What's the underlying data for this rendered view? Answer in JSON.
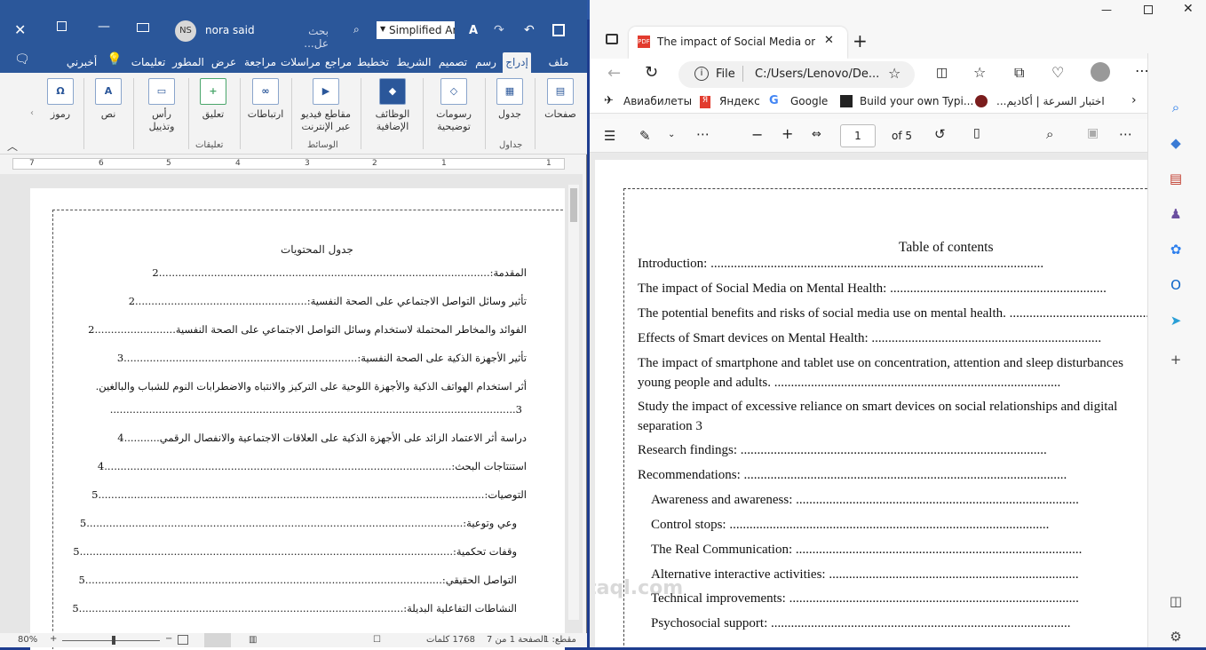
{
  "word": {
    "user_initials": "NS",
    "user_name": "nora said",
    "search_placeholder": "بحث عل...",
    "font_name": "Simplified Ara",
    "tabs": [
      "ملف",
      "إدراج",
      "رسم",
      "تصميم",
      "الشريط",
      "تخطيط",
      "مراجع",
      "مراسلات",
      "مراجعة",
      "عرض",
      "المطور",
      "تعليمات",
      "أخبرني"
    ],
    "active_tab": "إدراج",
    "ribbon": {
      "pages": "صفحات",
      "table": "جدول",
      "illustrations": "رسومات توضيحية",
      "addins": "الوظائف الإضافية",
      "online_video": "مقاطع فيديو عبر الإنترنت",
      "links": "ارتباطات",
      "comment": "تعليق",
      "header_footer": "رأس وتذييل",
      "text": "نص",
      "symbols": "رموز",
      "group_tables": "جداول",
      "group_media": "الوسائط",
      "group_comments": "تعليقات"
    },
    "ruler_numbers": [
      "7",
      "6",
      "5",
      "4",
      "3",
      "2",
      "1",
      "1",
      "2",
      "3"
    ],
    "toc_title": "جدول المحتويات",
    "toc": [
      {
        "text": "المقدمة:......................................................................................................2"
      },
      {
        "text": "تأثير وسائل التواصل الاجتماعي على الصحة النفسية:.....................................................2"
      },
      {
        "text": "الفوائد والمخاطر المحتملة لاستخدام وسائل التواصل الاجتماعي على الصحة النفسية.........................2"
      },
      {
        "text": "تأثير الأجهزة الذكية على الصحة النفسية:........................................................................3"
      },
      {
        "text": "أثر استخدام الهواتف الذكية والأجهزة اللوحية على التركيز والانتباه والاضطرابات النوم للشباب والبالغين."
      },
      {
        "text": "3............................................................................................................................."
      },
      {
        "text": "دراسة أثر الاعتماد الزائد على الأجهزة الذكية على العلاقات الاجتماعية والانفصال الرقمي...........4"
      },
      {
        "text": "استنتاجات البحث:...........................................................................................................4"
      },
      {
        "text": "التوصيات:.......................................................................................................................5"
      },
      {
        "text": "وعي وتوعية:....................................................................................................................5"
      },
      {
        "text": "وقفات تحكمية:...................................................................................................................5"
      },
      {
        "text": "التواصل الحقيقي:..............................................................................................................5"
      },
      {
        "text": "النشاطات التفاعلية البديلة:....................................................................................................5"
      }
    ],
    "status": {
      "zoom": "80%",
      "words": "1768 كلمات",
      "page": "الصفحة 1 من 7",
      "section": "مقطع: 1"
    }
  },
  "edge": {
    "tab_title": "The impact of Social Media on M",
    "url_label": "File",
    "url": "C:/Users/Lenovo/De...",
    "favorites": [
      "Авиабилеты",
      "Яндекс",
      "Google",
      "Build your own Typi...",
      "اختبار السرعة | أكاديم..."
    ],
    "pdf": {
      "page_current": "1",
      "page_total": "of 5"
    },
    "toc_title": "Table of contents",
    "toc": [
      "Introduction: ....................................................................................................",
      "The impact of Social Media on Mental Health: .................................................................",
      "The potential benefits and risks of social media use on mental health. ..........................................",
      "Effects of Smart devices on Mental Health: .....................................................................",
      "The impact of smartphone and tablet use on concentration, attention and sleep disturbances",
      "young people and adults. ......................................................................................",
      "Study the impact of excessive reliance on smart devices on social relationships and digital",
      "separation 3",
      "Research findings: ............................................................................................",
      "Recommendations: .................................................................................................",
      "Awareness and awareness: .....................................................................................",
      "Control stops: ................................................................................................",
      "The Real Communication: ......................................................................................",
      "Alternative interactive activities: ...........................................................................",
      "Technical improvements: .......................................................................................",
      "Psychosocial support: .........................................................................................."
    ]
  },
  "watermark": "mostaql.com"
}
